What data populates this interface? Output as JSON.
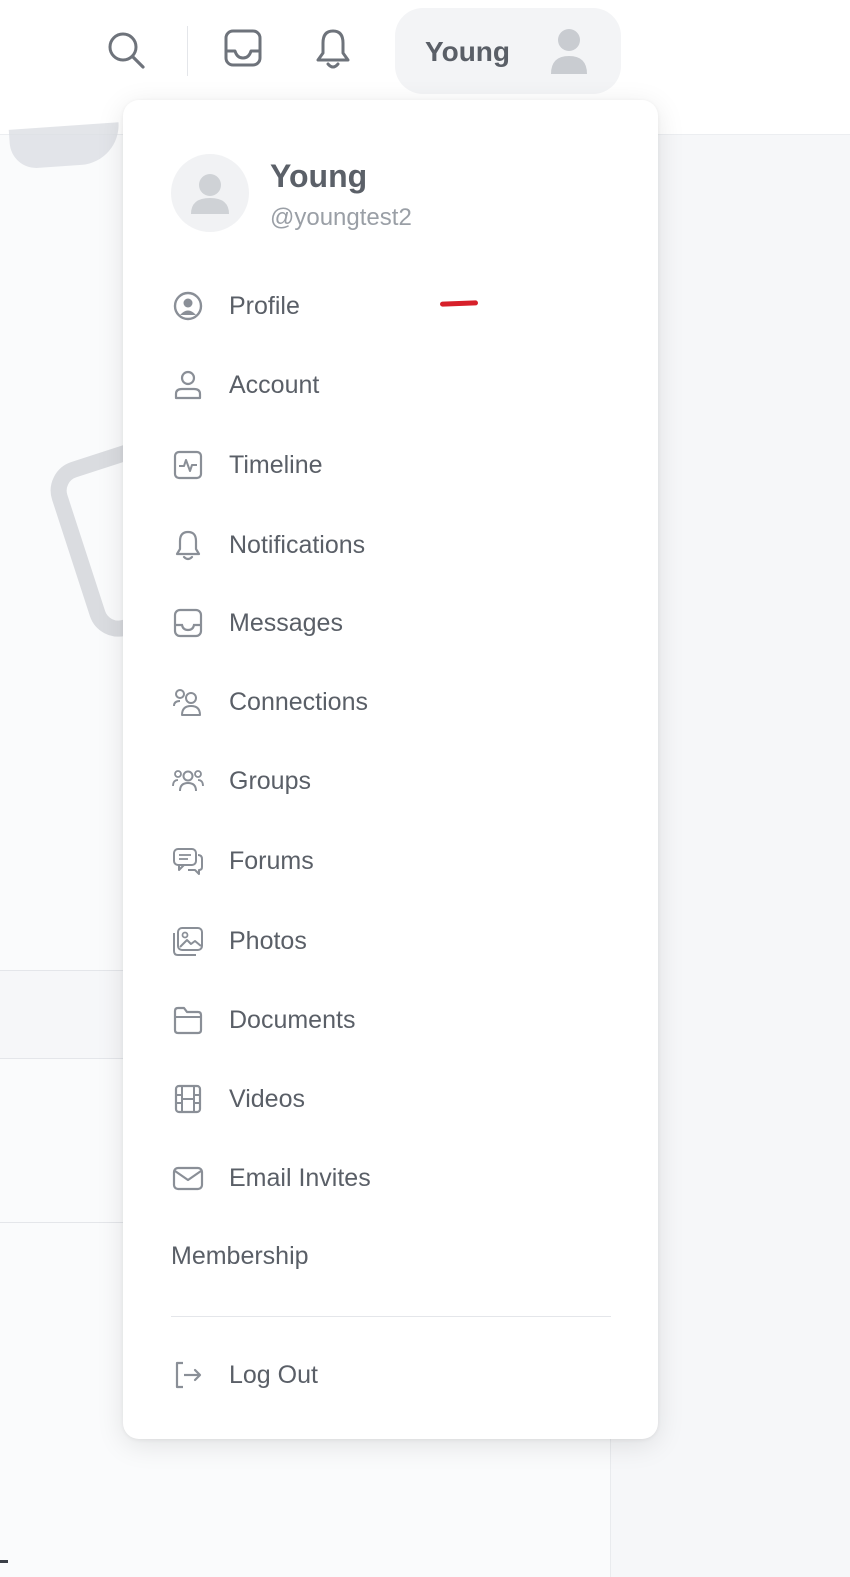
{
  "topbar": {
    "icons": [
      "search-icon",
      "inbox-icon",
      "bell-icon"
    ],
    "user_name": "Young"
  },
  "menu": {
    "user": {
      "name": "Young",
      "handle": "@youngtest2"
    },
    "items": [
      {
        "label": "Profile",
        "icon": "profile-circle-icon"
      },
      {
        "label": "Account",
        "icon": "user-icon"
      },
      {
        "label": "Timeline",
        "icon": "activity-icon"
      },
      {
        "label": "Notifications",
        "icon": "bell-icon"
      },
      {
        "label": "Messages",
        "icon": "inbox-icon"
      },
      {
        "label": "Connections",
        "icon": "connections-icon"
      },
      {
        "label": "Groups",
        "icon": "groups-icon"
      },
      {
        "label": "Forums",
        "icon": "forums-icon"
      },
      {
        "label": "Photos",
        "icon": "photos-icon"
      },
      {
        "label": "Documents",
        "icon": "folder-icon"
      },
      {
        "label": "Videos",
        "icon": "film-icon"
      },
      {
        "label": "Email Invites",
        "icon": "envelope-icon"
      },
      {
        "label": "Membership"
      },
      {
        "label": "Log Out",
        "icon": "logout-icon"
      }
    ]
  },
  "colors": {
    "annotation_mark": "#d7202a",
    "menu_text": "#5a5f67",
    "icon_stroke": "#8a8f97"
  }
}
